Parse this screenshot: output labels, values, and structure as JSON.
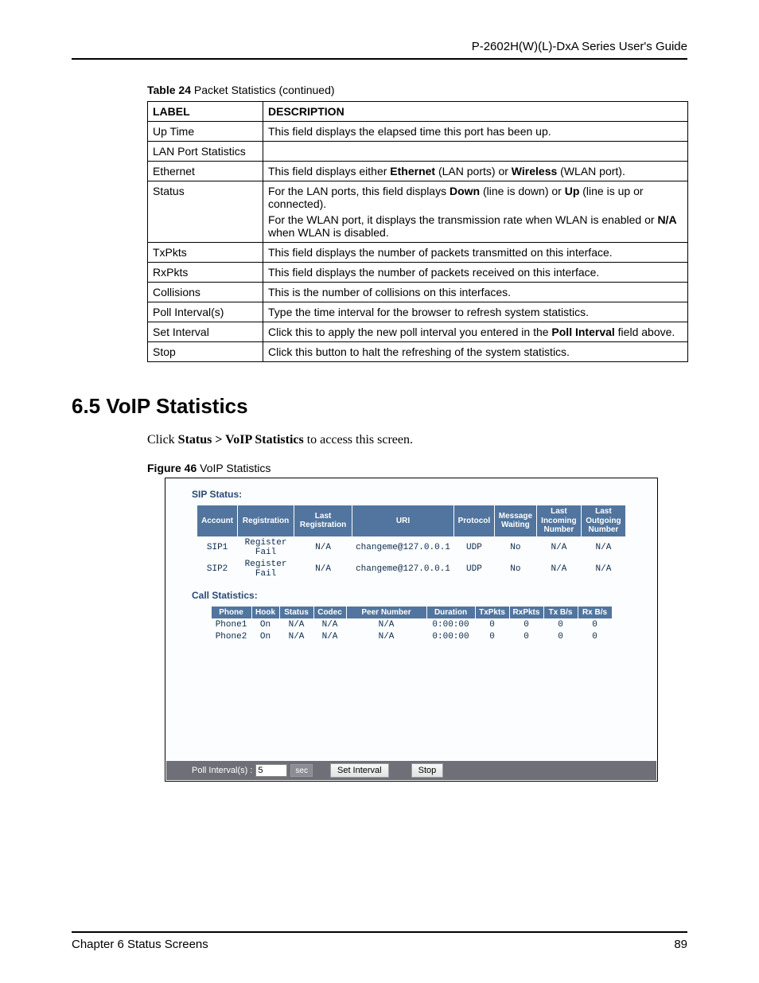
{
  "header": {
    "guide_title": "P-2602H(W)(L)-DxA Series User's Guide"
  },
  "table24": {
    "caption_bold": "Table 24",
    "caption_rest": "   Packet Statistics (continued)",
    "col_label": "LABEL",
    "col_desc": "DESCRIPTION",
    "rows": [
      {
        "label": "Up Time",
        "desc": [
          [
            "This field displays the elapsed time this port has been up."
          ]
        ]
      },
      {
        "label": "LAN Port Statistics",
        "desc": [
          [
            ""
          ]
        ]
      },
      {
        "label": "Ethernet",
        "desc": [
          [
            "This field displays either ",
            {
              "b": "Ethernet"
            },
            " (LAN ports) or ",
            {
              "b": "Wireless"
            },
            " (WLAN port)."
          ]
        ]
      },
      {
        "label": "Status",
        "desc": [
          [
            "For the LAN ports, this field displays ",
            {
              "b": "Down"
            },
            " (line is down) or ",
            {
              "b": "Up"
            },
            " (line is up or connected)."
          ],
          [
            "For the WLAN port, it displays the transmission rate when WLAN is enabled or ",
            {
              "b": "N/A"
            },
            " when WLAN is disabled."
          ]
        ]
      },
      {
        "label": "TxPkts",
        "desc": [
          [
            "This field displays the number of packets transmitted on this interface."
          ]
        ]
      },
      {
        "label": "RxPkts",
        "desc": [
          [
            "This field displays the number of packets received on this interface."
          ]
        ]
      },
      {
        "label": "Collisions",
        "desc": [
          [
            "This is the number of collisions on this interfaces."
          ]
        ]
      },
      {
        "label": "Poll Interval(s)",
        "desc": [
          [
            "Type the time interval for the browser to refresh system statistics."
          ]
        ]
      },
      {
        "label": "Set Interval",
        "desc": [
          [
            "Click this to apply the new poll interval you entered in the ",
            {
              "b": "Poll Interval"
            },
            " field above."
          ]
        ]
      },
      {
        "label": "Stop",
        "desc": [
          [
            "Click this button to halt the refreshing of the system statistics."
          ]
        ]
      }
    ]
  },
  "section": {
    "heading": "6.5  VoIP Statistics",
    "intro_pre": "Click ",
    "intro_bold": "Status > VoIP Statistics",
    "intro_post": " to access this screen."
  },
  "figure46": {
    "caption_bold": "Figure 46",
    "caption_rest": "   VoIP Statistics"
  },
  "ui": {
    "sip_title": "SIP Status:",
    "call_title": "Call Statistics:",
    "sip_headers": [
      "Account",
      "Registration",
      "Last Registration",
      "URI",
      "Protocol",
      "Message Waiting",
      "Last Incoming Number",
      "Last Outgoing Number"
    ],
    "sip_rows": [
      [
        "SIP1",
        "Register Fail",
        "N/A",
        "changeme@127.0.0.1",
        "UDP",
        "No",
        "N/A",
        "N/A"
      ],
      [
        "SIP2",
        "Register Fail",
        "N/A",
        "changeme@127.0.0.1",
        "UDP",
        "No",
        "N/A",
        "N/A"
      ]
    ],
    "call_headers": [
      "Phone",
      "Hook",
      "Status",
      "Codec",
      "Peer Number",
      "Duration",
      "TxPkts",
      "RxPkts",
      "Tx B/s",
      "Rx B/s"
    ],
    "call_rows": [
      [
        "Phone1",
        "On",
        "N/A",
        "N/A",
        "N/A",
        "0:00:00",
        "0",
        "0",
        "0",
        "0"
      ],
      [
        "Phone2",
        "On",
        "N/A",
        "N/A",
        "N/A",
        "0:00:00",
        "0",
        "0",
        "0",
        "0"
      ]
    ],
    "poll_label": "Poll Interval(s) :",
    "poll_value": "5",
    "sec_label": "sec",
    "set_interval": "Set Interval",
    "stop": "Stop"
  },
  "footer": {
    "left": "Chapter 6 Status Screens",
    "right": "89"
  }
}
